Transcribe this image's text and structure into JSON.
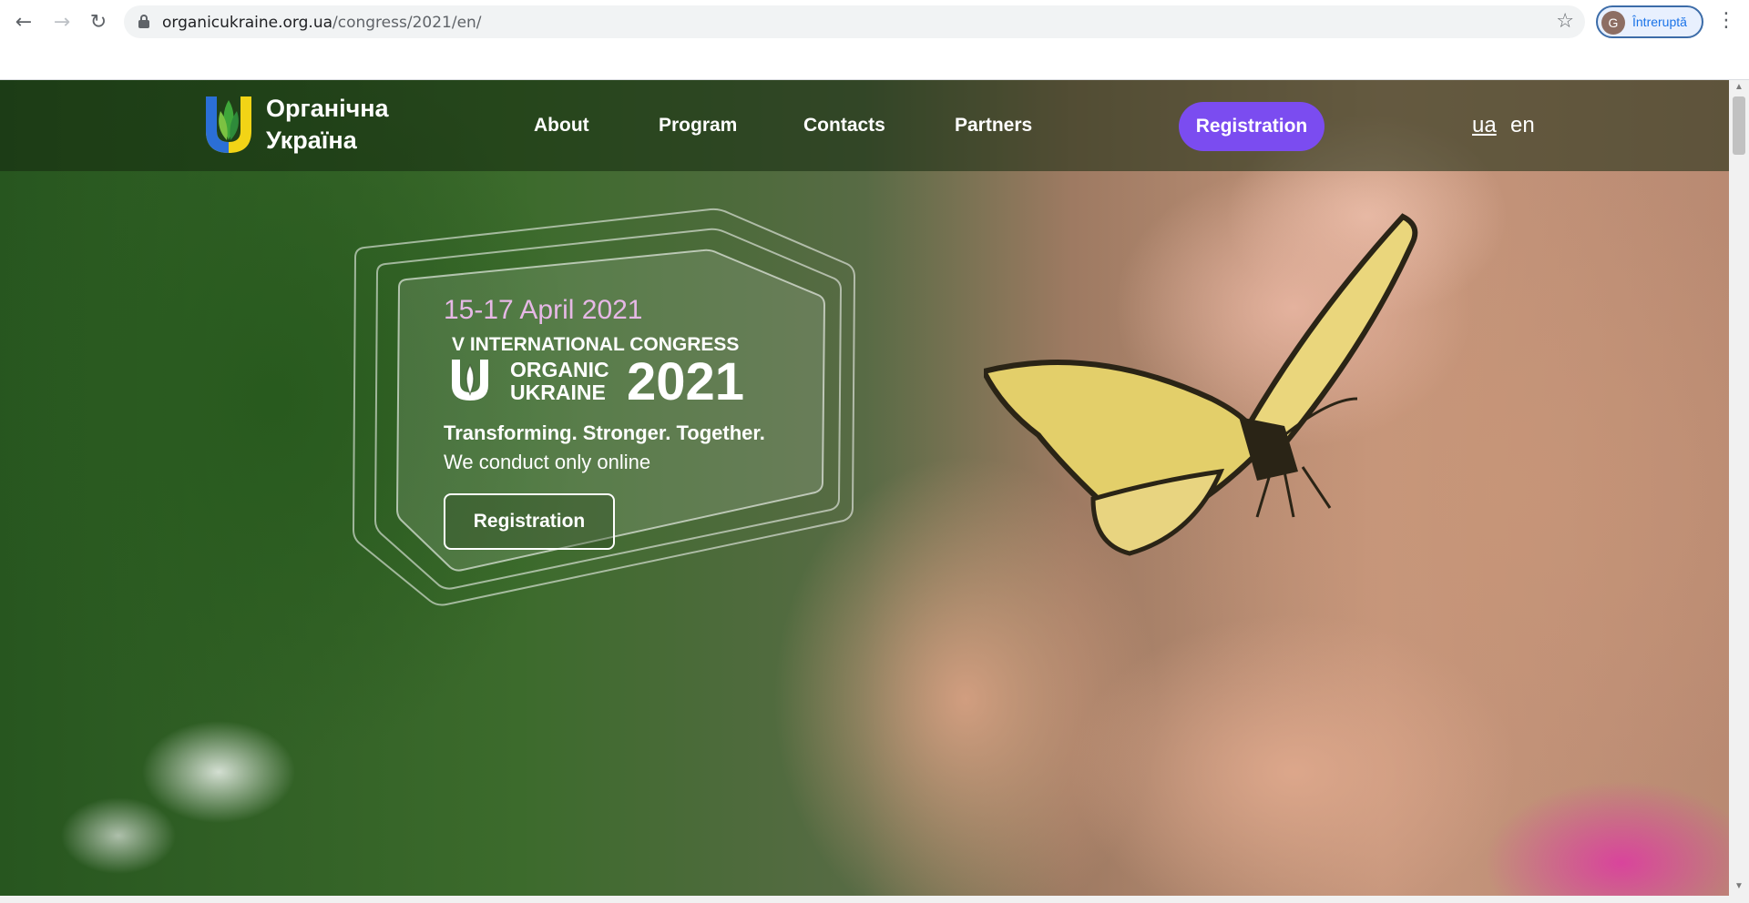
{
  "browser": {
    "back_icon": "←",
    "forward_icon": "→",
    "reload_icon": "↻",
    "url_host": "organicukraine.org.ua",
    "url_path": "/congress/2021/en/",
    "star_icon": "☆",
    "profile_initial": "G",
    "profile_status": "Întreruptă",
    "menu_icon": "⋮"
  },
  "site": {
    "logo_text_line1": "Органічна",
    "logo_text_line2": "Україна",
    "nav": {
      "about": "About",
      "program": "Program",
      "contacts": "Contacts",
      "partners": "Partners",
      "registration": "Registration"
    },
    "languages": {
      "ua": "ua",
      "en": "en"
    },
    "accent_color": "#7b4cf0"
  },
  "hero": {
    "date": "15-17 April 2021",
    "congress": "V INTERNATIONAL CONGRESS",
    "brand_line1": "ORGANIC",
    "brand_line2": "UKRAINE",
    "year": "2021",
    "tagline": "Transforming. Stronger. Together.",
    "subtitle": "We conduct only online",
    "button": "Registration"
  }
}
